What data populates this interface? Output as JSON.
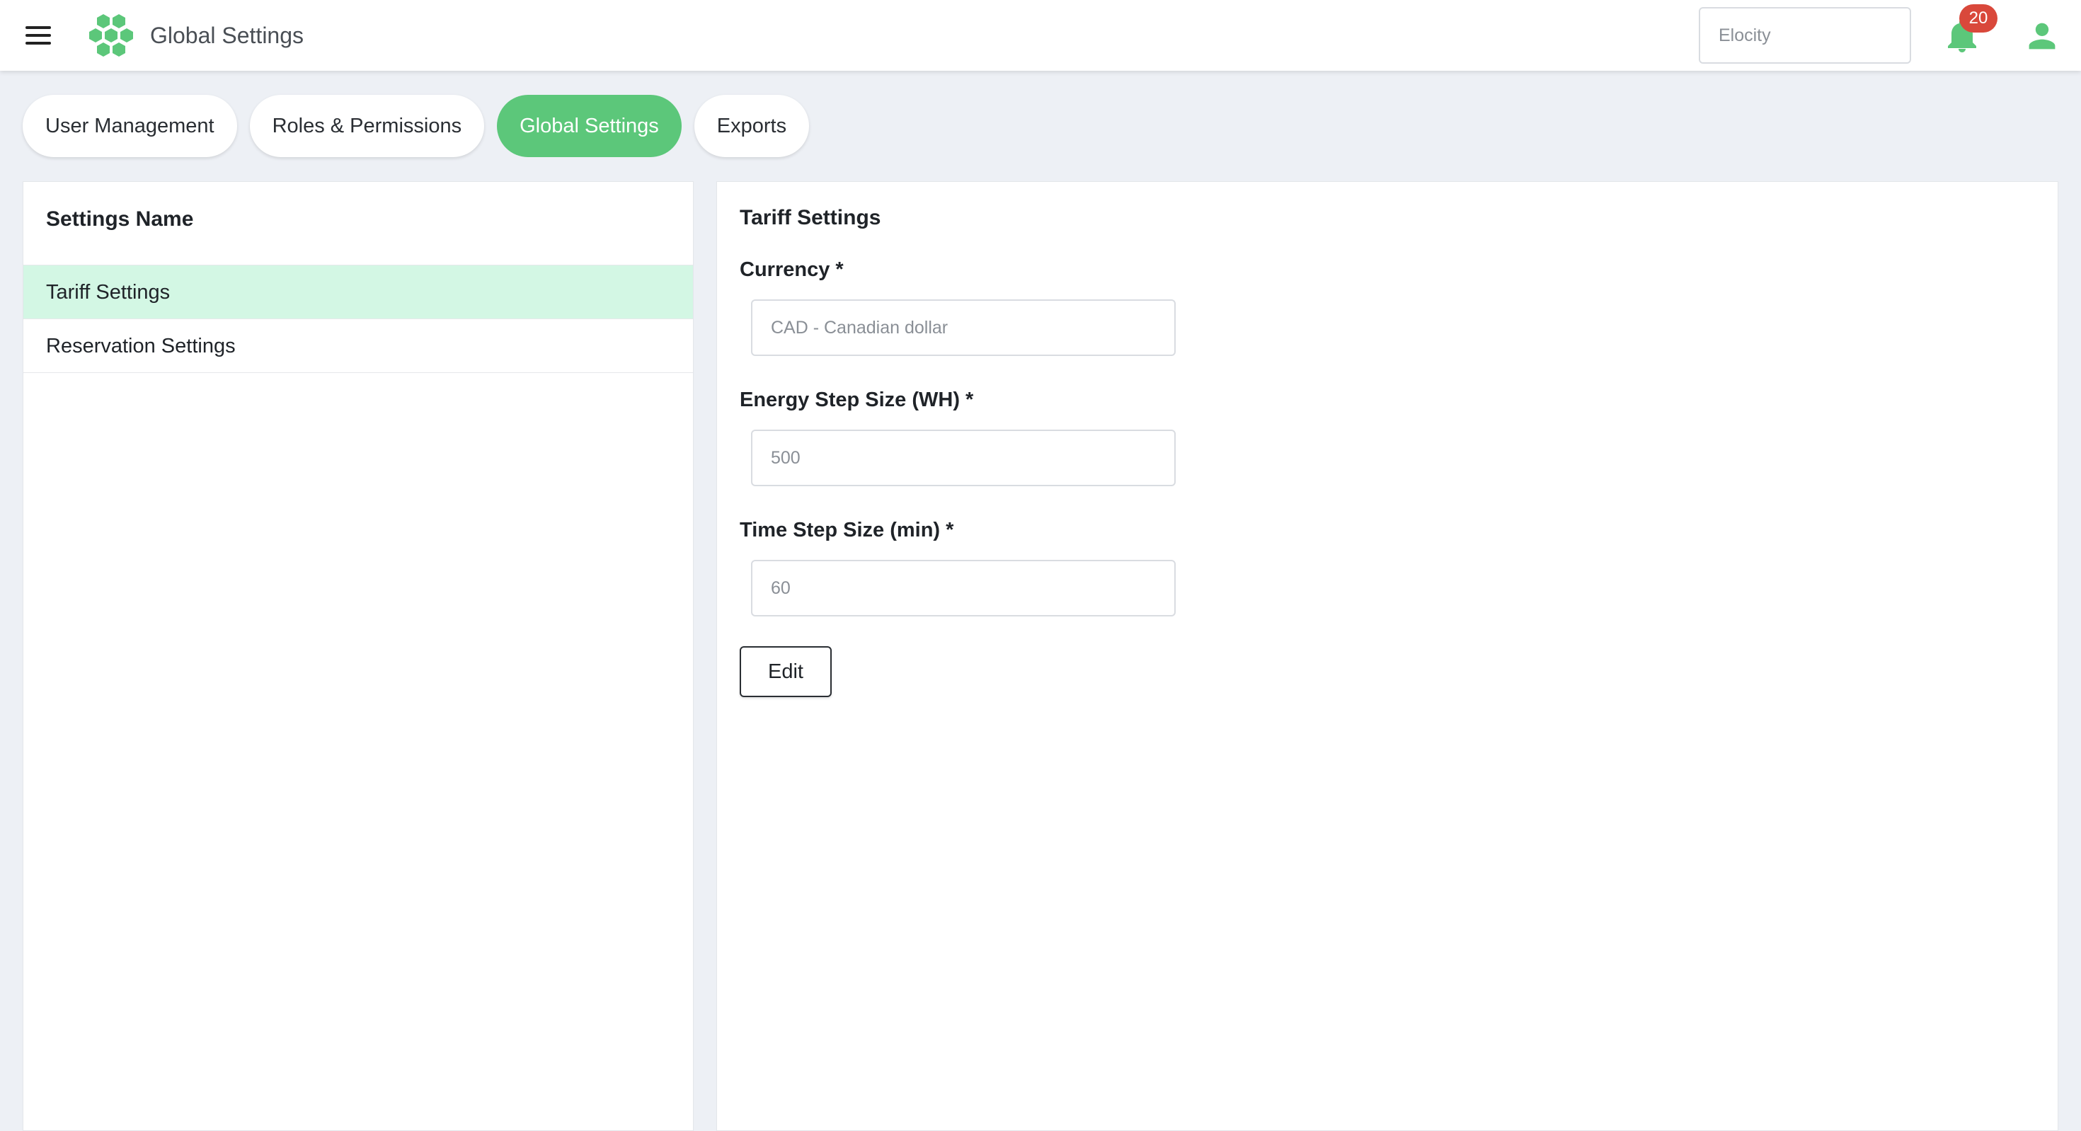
{
  "header": {
    "title": "Global Settings",
    "search_placeholder": "Elocity",
    "notification_count": "20",
    "menu_icon": "hamburger-menu-icon",
    "logo_icon": "hexagon-cluster-logo",
    "bell_icon": "bell-icon",
    "user_icon": "user-icon"
  },
  "tabs": [
    {
      "label": "User Management",
      "active": false
    },
    {
      "label": "Roles & Permissions",
      "active": false
    },
    {
      "label": "Global Settings",
      "active": true
    },
    {
      "label": "Exports",
      "active": false
    }
  ],
  "settings_list": {
    "header": "Settings Name",
    "items": [
      {
        "label": "Tariff Settings",
        "active": true
      },
      {
        "label": "Reservation Settings",
        "active": false
      }
    ]
  },
  "tariff": {
    "title": "Tariff Settings",
    "currency_label": "Currency *",
    "currency_placeholder": "CAD - Canadian dollar",
    "energy_label": "Energy Step Size (WH) *",
    "energy_placeholder": "500",
    "time_label": "Time Step Size (min) *",
    "time_placeholder": "60",
    "edit_label": "Edit"
  },
  "colors": {
    "accent": "#5cc77a",
    "active_row": "#d3f7e4",
    "badge": "#d9483b",
    "background": "#edf0f5"
  }
}
